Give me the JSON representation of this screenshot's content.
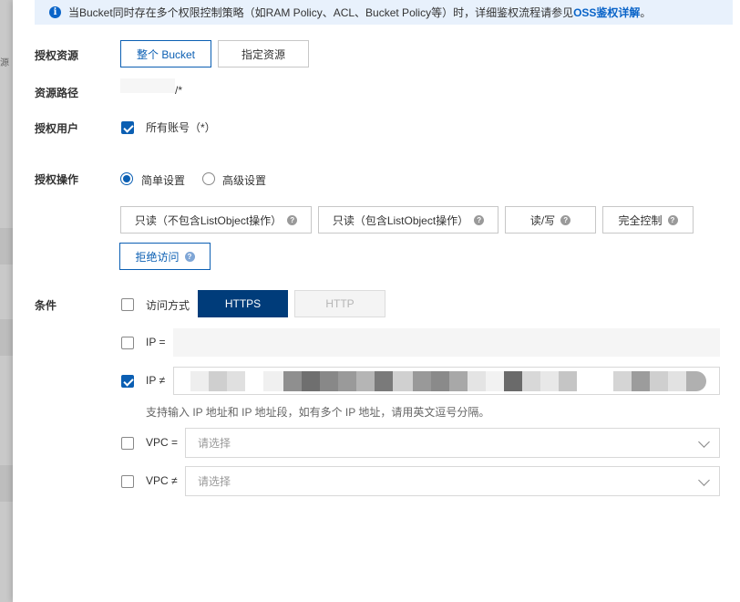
{
  "notice": {
    "text": "当Bucket同时存在多个权限控制策略（如RAM Policy、ACL、Bucket Policy等）时，详细鉴权流程请参见",
    "link": "OSS鉴权详解",
    "suffix": "。"
  },
  "left_strip_text": "源",
  "resource": {
    "label": "授权资源",
    "options": [
      "整个 Bucket",
      "指定资源"
    ],
    "selected": "整个 Bucket"
  },
  "resource_path": {
    "label": "资源路径",
    "value": "/*"
  },
  "user": {
    "label": "授权用户",
    "option": "所有账号（*）",
    "checked": true
  },
  "operation": {
    "label": "授权操作",
    "modes": [
      "简单设置",
      "高级设置"
    ],
    "selected_mode": "简单设置",
    "actions": [
      "只读（不包含ListObject操作）",
      "只读（包含ListObject操作）",
      "读/写",
      "完全控制",
      "拒绝访问"
    ],
    "selected_action": "拒绝访问"
  },
  "conditions": {
    "label": "条件",
    "access_method": {
      "label": "访问方式",
      "checked": false,
      "protocols": [
        "HTTPS",
        "HTTP"
      ],
      "selected_protocol": "HTTPS"
    },
    "ip_eq": {
      "label": "IP =",
      "checked": false,
      "value": ""
    },
    "ip_neq": {
      "label": "IP ≠",
      "checked": true,
      "value": ""
    },
    "hint": "支持输入 IP 地址和 IP 地址段，如有多个 IP 地址，请用英文逗号分隔。",
    "vpc_eq": {
      "label": "VPC =",
      "checked": false,
      "placeholder": "请选择"
    },
    "vpc_neq": {
      "label": "VPC ≠",
      "checked": false,
      "placeholder": "请选择"
    }
  },
  "colors": {
    "accent": "#0b5fb3",
    "https_active": "#003c7a",
    "notice_bg": "#e8f1fc"
  },
  "icons": {
    "info": "info-icon",
    "help": "question-icon",
    "checkbox_checked": "checkbox-checked-icon",
    "radio_selected": "radio-selected-icon",
    "dropdown": "chevron-down-icon"
  }
}
